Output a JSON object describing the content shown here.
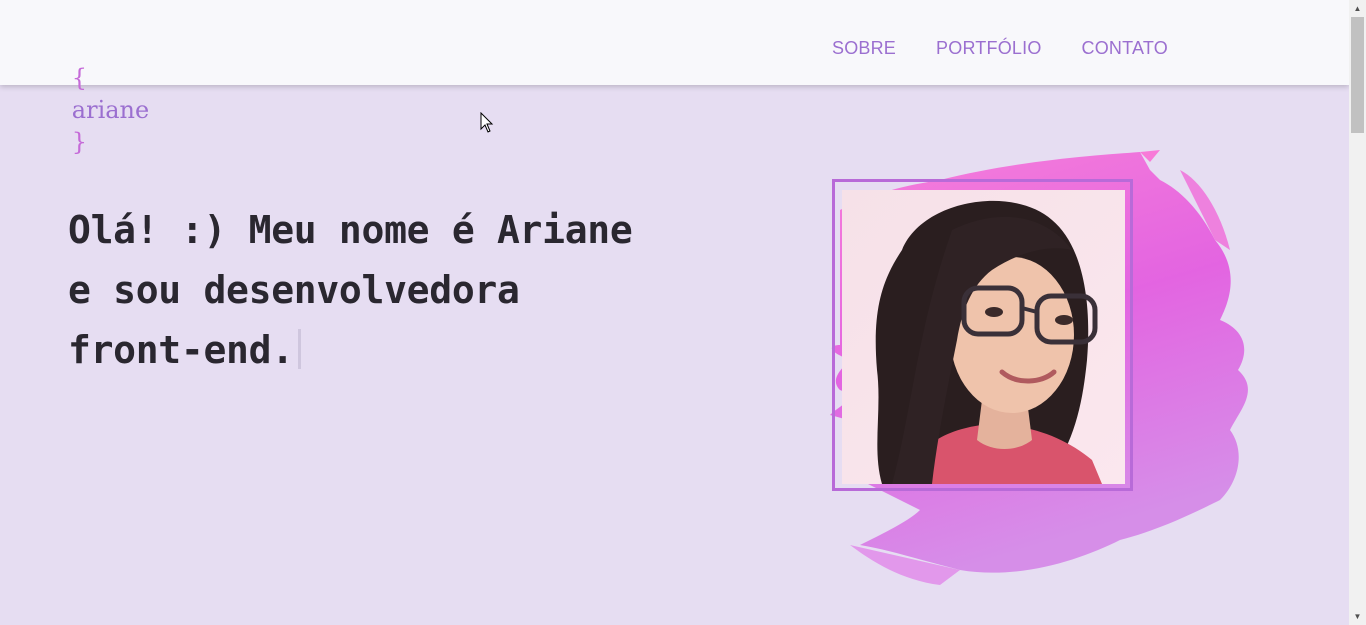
{
  "header": {
    "logo_open": "{",
    "logo_text": "ariane",
    "logo_close": "}",
    "nav": [
      {
        "label": "SOBRE"
      },
      {
        "label": "PORTFÓLIO"
      },
      {
        "label": "CONTATO"
      }
    ]
  },
  "hero": {
    "line1": "Olá! :) Meu nome é Ariane",
    "line2": "e sou desenvolvedora",
    "line3": "front-end."
  },
  "colors": {
    "accent": "#9b6fd0",
    "background": "#e6ddf2",
    "frame": "#b86ad8",
    "brush_pink": "#f06ad8"
  },
  "icons": {
    "scroll_up": "arrow-up-icon",
    "scroll_down": "arrow-down-icon",
    "cursor": "mouse-pointer-icon"
  }
}
